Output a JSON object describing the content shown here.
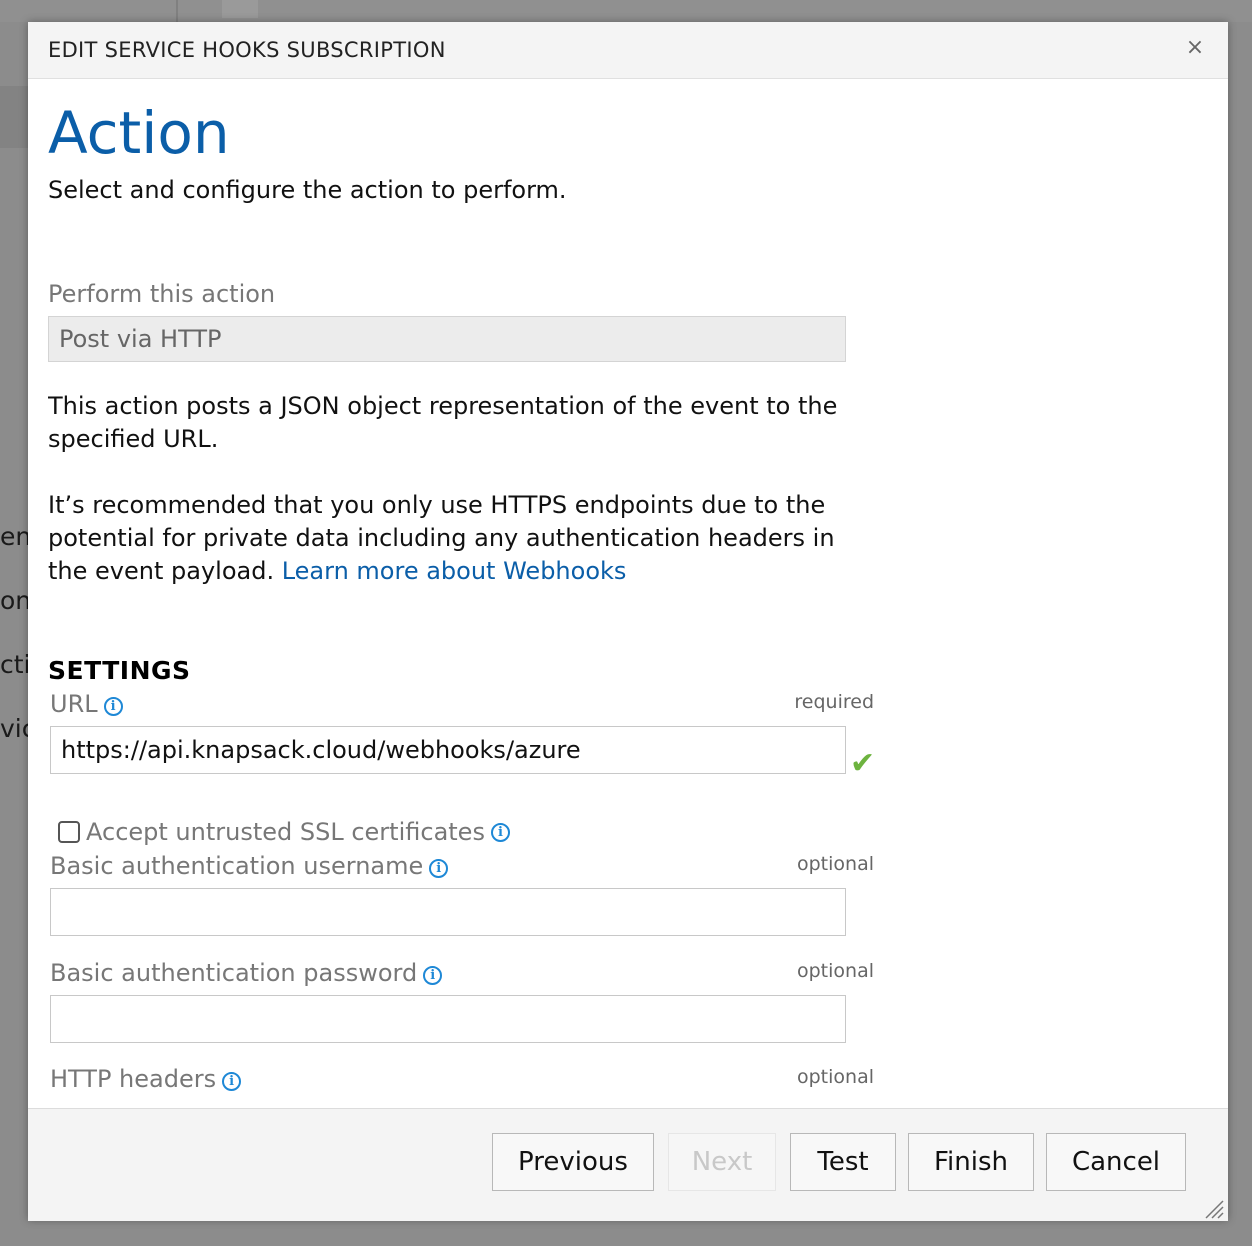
{
  "background": {
    "fragments": [
      "ent",
      "on",
      "ctic",
      "vic"
    ]
  },
  "dialog": {
    "title": "EDIT SERVICE HOOKS SUBSCRIPTION",
    "close_icon": "×"
  },
  "page": {
    "title": "Action",
    "subtitle": "Select and configure the action to perform."
  },
  "action": {
    "label": "Perform this action",
    "value": "Post via HTTP",
    "description": "This action posts a JSON object representation of the event to the specified URL.",
    "recommendation": "It’s recommended that you only use HTTPS endpoints due to the potential for private data including any authentication headers in the event payload.",
    "learn_more_link": "Learn more about Webhooks"
  },
  "settings": {
    "heading": "SETTINGS",
    "url": {
      "label": "URL",
      "requirement": "required",
      "value": "https://api.knapsack.cloud/webhooks/azure",
      "valid": true
    },
    "accept_untrusted_ssl": {
      "label": "Accept untrusted SSL certificates",
      "checked": false
    },
    "basic_auth_username": {
      "label": "Basic authentication username",
      "requirement": "optional",
      "value": ""
    },
    "basic_auth_password": {
      "label": "Basic authentication password",
      "requirement": "optional",
      "value": ""
    },
    "http_headers": {
      "label": "HTTP headers",
      "requirement": "optional"
    }
  },
  "footer": {
    "previous": "Previous",
    "next": "Next",
    "test": "Test",
    "finish": "Finish",
    "cancel": "Cancel"
  },
  "colors": {
    "accent": "#0b5ea8",
    "info_icon": "#1e88d6",
    "valid_check": "#6db33f"
  },
  "icons": {
    "close": "close-icon",
    "info": "info-icon",
    "valid": "check-icon",
    "resize": "resize-grip-icon"
  }
}
